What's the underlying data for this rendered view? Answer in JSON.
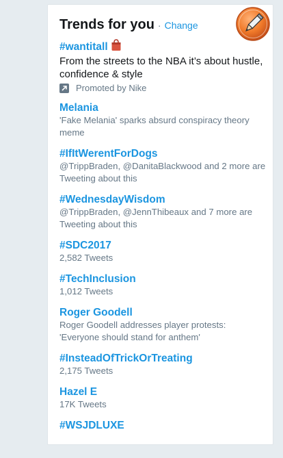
{
  "header": {
    "title": "Trends for you",
    "separator": "·",
    "change_label": "Change"
  },
  "trends": [
    {
      "name": "#wantitall",
      "description": "From the streets to the NBA it’s about hustle, confidence & style",
      "promoted_label": "Promoted by Nike"
    },
    {
      "name": "Melania",
      "description": "'Fake Melania' sparks absurd conspiracy theory meme"
    },
    {
      "name": "#IfItWerentForDogs",
      "description": "@TrippBraden, @DanitaBlackwood and 2 more are Tweeting about this"
    },
    {
      "name": "#WednesdayWisdom",
      "description": "@TrippBraden, @JennThibeaux and 7 more are Tweeting about this"
    },
    {
      "name": "#SDC2017",
      "description": "2,582 Tweets"
    },
    {
      "name": "#TechInclusion",
      "description": "1,012 Tweets"
    },
    {
      "name": "Roger Goodell",
      "description": "Roger Goodell addresses player protests: 'Everyone should stand for anthem'"
    },
    {
      "name": "#InsteadOfTrickOrTreating",
      "description": "2,175 Tweets"
    },
    {
      "name": "Hazel E",
      "description": "17K Tweets"
    },
    {
      "name": "#WSJDLUXE"
    }
  ],
  "colors": {
    "link": "#1b95e0",
    "text": "#14171a",
    "muted": "#657786",
    "background": "#e6ecf0",
    "pencil_orange": "#f07a2a"
  },
  "icons": [
    "promoted-arrow-icon",
    "shopping-bag-icon",
    "pencil-edit-icon"
  ]
}
